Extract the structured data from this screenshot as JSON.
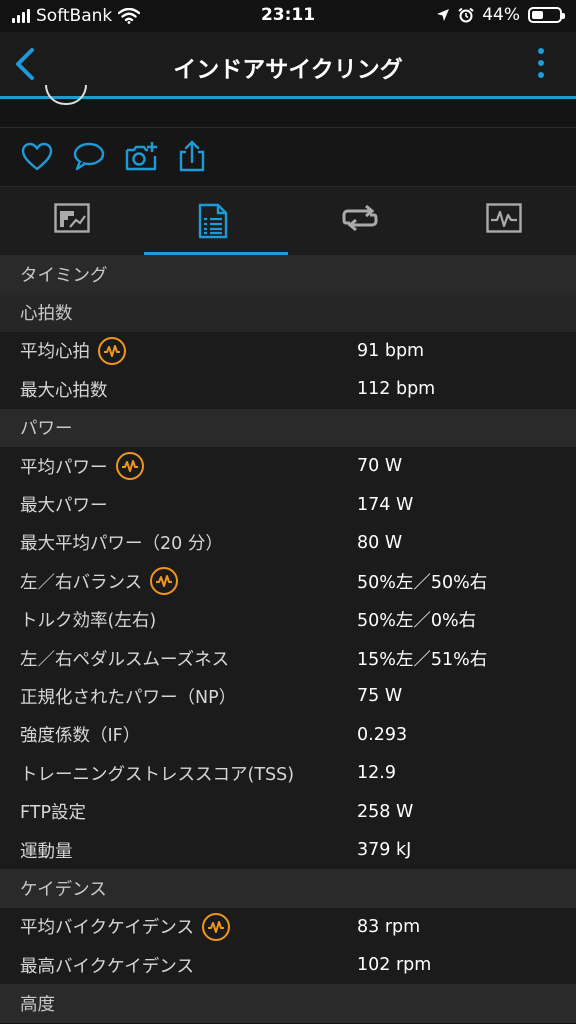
{
  "status_bar": {
    "carrier": "SoftBank",
    "time": "23:11",
    "battery_percent": "44%",
    "battery_level": 0.44,
    "icons": [
      "signal-icon",
      "wifi-icon",
      "location-icon",
      "alarm-icon",
      "battery-icon"
    ]
  },
  "nav": {
    "title": "インドアサイクリング",
    "back_icon": "chevron-left-icon",
    "menu_icon": "vertical-dots-icon"
  },
  "actions": [
    "like-icon",
    "comment-icon",
    "add-photo-icon",
    "share-icon"
  ],
  "tabs": [
    {
      "name": "overview",
      "icon": "chart-icon",
      "active": false
    },
    {
      "name": "stats",
      "icon": "document-list-icon",
      "active": true
    },
    {
      "name": "laps",
      "icon": "repeat-icon",
      "active": false
    },
    {
      "name": "graphs",
      "icon": "waveform-icon",
      "active": false
    }
  ],
  "sections": {
    "timing": "タイミング",
    "heart_rate": "心拍数",
    "power": "パワー",
    "cadence": "ケイデンス",
    "elevation": "高度"
  },
  "rows": {
    "avg_hr": {
      "label": "平均心拍",
      "value": "91 bpm"
    },
    "max_hr": {
      "label": "最大心拍数",
      "value": "112 bpm"
    },
    "avg_power": {
      "label": "平均パワー",
      "value": "70 W"
    },
    "max_power": {
      "label": "最大パワー",
      "value": "174 W"
    },
    "max_avg_power": {
      "label": "最大平均パワー（20 分）",
      "value": "80 W"
    },
    "lr_balance": {
      "label": "左／右バランス",
      "value": "50%左／50%右"
    },
    "torque_eff": {
      "label": "トルク効率(左右)",
      "value": "50%左／0%右"
    },
    "pedal_smooth": {
      "label": "左／右ペダルスムーズネス",
      "value": "15%左／51%右"
    },
    "np": {
      "label": "正規化されたパワー（NP）",
      "value": "75 W"
    },
    "if": {
      "label": "強度係数（IF）",
      "value": "0.293"
    },
    "tss": {
      "label": "トレーニングストレススコア(TSS)",
      "value": "12.9"
    },
    "ftp": {
      "label": "FTP設定",
      "value": "258 W"
    },
    "work": {
      "label": "運動量",
      "value": "379 kJ"
    },
    "avg_cadence": {
      "label": "平均バイクケイデンス",
      "value": "83 rpm"
    },
    "max_cadence": {
      "label": "最高バイクケイデンス",
      "value": "102 rpm"
    }
  },
  "colors": {
    "accent": "#1e9bd7",
    "badge": "#f0961c",
    "background": "#121212",
    "section_bg": "#2a2a2a",
    "row_bg": "#1b1b1b"
  }
}
